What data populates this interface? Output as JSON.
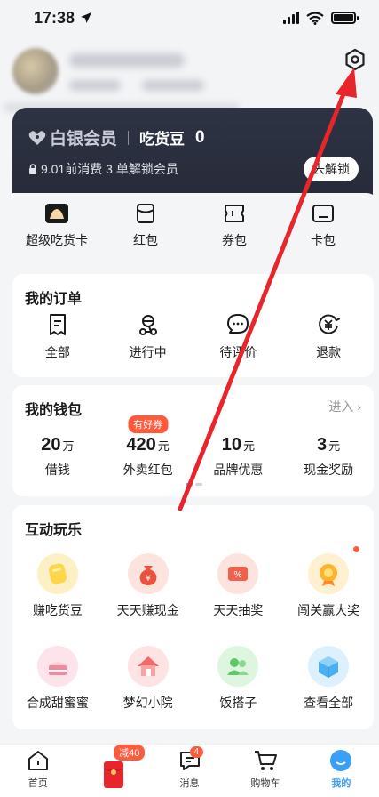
{
  "status_bar": {
    "time": "17:38"
  },
  "member": {
    "logo_text": "白银会员",
    "bean_label": "吃货豆",
    "bean_value": "0",
    "unlock_hint": "9.01前消费 3 单解锁会员",
    "unlock_button": "去解锁"
  },
  "quick_actions": [
    {
      "label": "超级吃货卡",
      "icon": "super-card-icon"
    },
    {
      "label": "红包",
      "icon": "red-packet-icon"
    },
    {
      "label": "券包",
      "icon": "coupon-icon"
    },
    {
      "label": "卡包",
      "icon": "card-wallet-icon"
    }
  ],
  "orders": {
    "title": "我的订单",
    "items": [
      {
        "label": "全部",
        "icon": "order-all-icon"
      },
      {
        "label": "进行中",
        "icon": "rider-icon"
      },
      {
        "label": "待评价",
        "icon": "comment-icon"
      },
      {
        "label": "退款",
        "icon": "refund-icon"
      }
    ]
  },
  "wallet": {
    "title": "我的钱包",
    "more": "进入",
    "items": [
      {
        "value": "20",
        "unit": "万",
        "label": "借钱",
        "badge": ""
      },
      {
        "value": "420",
        "unit": "元",
        "label": "外卖红包",
        "badge": "有好券"
      },
      {
        "value": "10",
        "unit": "元",
        "label": "品牌优惠",
        "badge": ""
      },
      {
        "value": "3",
        "unit": "元",
        "label": "现金奖励",
        "badge": ""
      }
    ]
  },
  "play": {
    "title": "互动玩乐",
    "items": [
      {
        "label": "赚吃货豆",
        "icon": "coin-icon",
        "color": "#ffd64a"
      },
      {
        "label": "天天赚现金",
        "icon": "money-bag-icon",
        "color": "#e8523f"
      },
      {
        "label": "天天抽奖",
        "icon": "lottery-ticket-icon",
        "color": "#f0604a"
      },
      {
        "label": "闯关赢大奖",
        "icon": "medal-icon",
        "color": "#ffb22e"
      },
      {
        "label": "合成甜蜜蜜",
        "icon": "cake-icon",
        "color": "#f08aa0"
      },
      {
        "label": "梦幻小院",
        "icon": "house-icon",
        "color": "#f26a6a"
      },
      {
        "label": "饭搭子",
        "icon": "friends-icon",
        "color": "#5cc86a"
      },
      {
        "label": "查看全部",
        "icon": "cube-icon",
        "color": "#4ab0f0"
      }
    ]
  },
  "tabbar": {
    "items": [
      {
        "label": "首页",
        "icon": "home-icon"
      },
      {
        "label": "",
        "icon": "red-envelope-icon",
        "badge": "减40"
      },
      {
        "label": "消息",
        "icon": "message-icon",
        "badge": "4"
      },
      {
        "label": "购物车",
        "icon": "cart-icon"
      },
      {
        "label": "我的",
        "icon": "profile-icon"
      }
    ]
  },
  "colors": {
    "accent": "#ff5a3c",
    "annotation_arrow": "#e8252a",
    "member_bg": "#2a2e3c"
  }
}
